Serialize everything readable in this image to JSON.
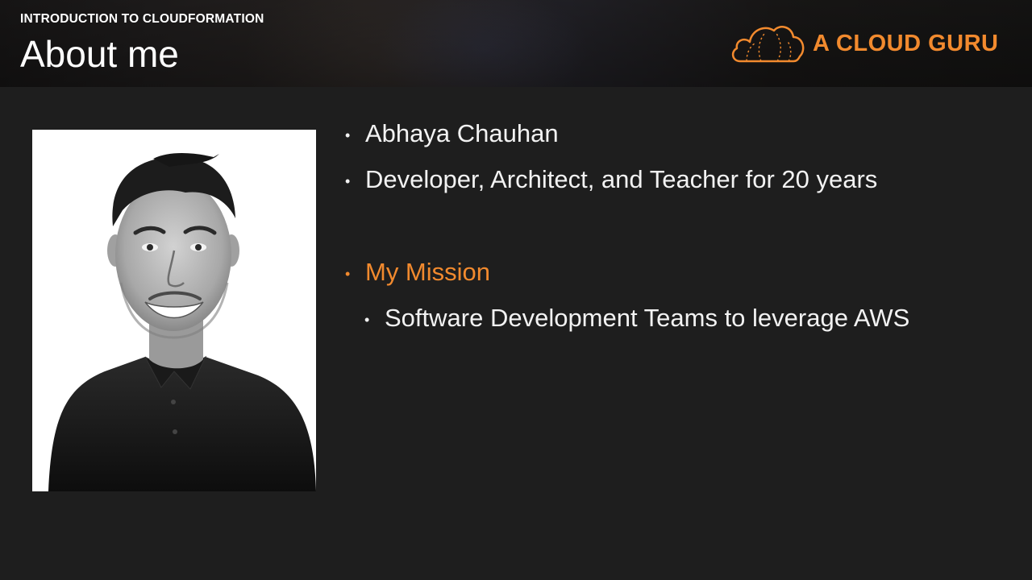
{
  "header": {
    "course_label": "INTRODUCTION TO CLOUDFORMATION",
    "title": "About me"
  },
  "brand": {
    "name": "A CLOUD GURU",
    "logo_icon": "cloud-logo-icon",
    "accent_color": "#f28a2e"
  },
  "photo": {
    "icon": "presenter-photo"
  },
  "bullets": [
    {
      "text": "Abhaya Chauhan",
      "level": 1
    },
    {
      "text": "Developer, Architect, and Teacher for 20 years",
      "level": 1
    },
    {
      "text": "My Mission",
      "level": 1,
      "color": "#f28a2e"
    },
    {
      "text": "Software Development Teams to leverage AWS",
      "level": 2
    }
  ],
  "bullet_glyph": "•"
}
